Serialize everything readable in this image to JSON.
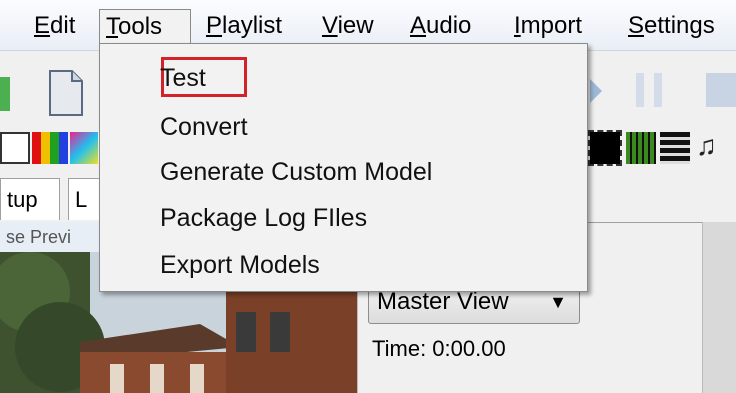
{
  "menubar": {
    "items": [
      {
        "label": "Edit",
        "underline": "E",
        "rest": "dit"
      },
      {
        "label": "Tools",
        "underline": "T",
        "rest": "ools"
      },
      {
        "label": "Playlist",
        "underline": "P",
        "rest": "laylist"
      },
      {
        "label": "View",
        "underline": "V",
        "rest": "iew"
      },
      {
        "label": "Audio",
        "underline": "A",
        "rest": "udio"
      },
      {
        "label": "Import",
        "underline": "I",
        "rest": "mport"
      },
      {
        "label": "Settings",
        "underline": "S",
        "rest": "ettings"
      }
    ],
    "open_menu": "Tools"
  },
  "tools_menu": {
    "items": [
      "Test",
      "Convert",
      "Generate Custom Model",
      "Package Log FIles",
      "Export Models"
    ],
    "highlighted": "Test",
    "highlight_color": "#d2232a"
  },
  "tabs": [
    {
      "label": "tup"
    },
    {
      "label": "L"
    }
  ],
  "preview_label": "se Previ",
  "right_panel": {
    "view_select": "Master View",
    "time": "Time: 0:00.00"
  }
}
